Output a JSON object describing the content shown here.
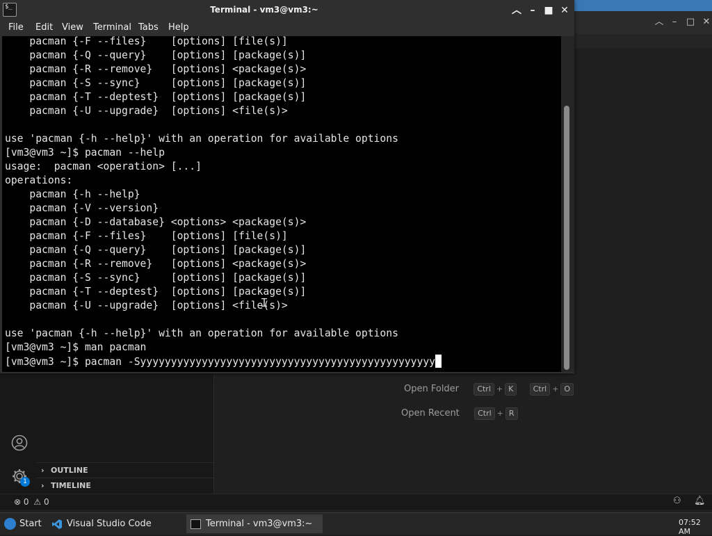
{
  "terminal": {
    "title": "Terminal - vm3@vm3:~",
    "menu": [
      "File",
      "Edit",
      "View",
      "Terminal",
      "Tabs",
      "Help"
    ],
    "lines": [
      "    pacman {-F --files}    [options] [file(s)]",
      "    pacman {-Q --query}    [options] [package(s)]",
      "    pacman {-R --remove}   [options] <package(s)>",
      "    pacman {-S --sync}     [options] [package(s)]",
      "    pacman {-T --deptest}  [options] [package(s)]",
      "    pacman {-U --upgrade}  [options] <file(s)>",
      "",
      "use 'pacman {-h --help}' with an operation for available options",
      "[vm3@vm3 ~]$ pacman --help",
      "usage:  pacman <operation> [...]",
      "operations:",
      "    pacman {-h --help}",
      "    pacman {-V --version}",
      "    pacman {-D --database} <options> <package(s)>",
      "    pacman {-F --files}    [options] [file(s)]",
      "    pacman {-Q --query}    [options] [package(s)]",
      "    pacman {-R --remove}   [options] <package(s)>",
      "    pacman {-S --sync}     [options] [package(s)]",
      "    pacman {-T --deptest}  [options] [package(s)]",
      "    pacman {-U --upgrade}  [options] <file(s)>",
      "",
      "use 'pacman {-h --help}' with an operation for available options",
      "[vm3@vm3 ~]$ man pacman"
    ],
    "prompt": "[vm3@vm3 ~]$ ",
    "input": "pacman -Syyyyyyyyyyyyyyyyyyyyyyyyyyyyyyyyyyyyyyyyyyyyyyyy"
  },
  "vscode": {
    "welcome": {
      "open_folder_label": "Open Folder",
      "open_folder_keys": [
        "Ctrl",
        "K",
        "Ctrl",
        "O"
      ],
      "open_recent_label": "Open Recent",
      "open_recent_keys": [
        "Ctrl",
        "R"
      ]
    },
    "panels": {
      "outline": "OUTLINE",
      "timeline": "TIMELINE"
    },
    "settings_badge": "1",
    "status": {
      "errors": "0",
      "warnings": "0"
    }
  },
  "taskbar": {
    "start_label": "Start",
    "tasks": [
      {
        "label": "Visual Studio Code",
        "icon": "vscode-icon"
      },
      {
        "label": "Terminal - vm3@vm3:~",
        "icon": "terminal-icon"
      }
    ],
    "clock": "07:52 AM"
  },
  "colors": {
    "terminal_bg": "#000000",
    "chrome": "#2f2f2f",
    "vscode_blue": "#3a78b4",
    "badge": "#0078d4"
  }
}
